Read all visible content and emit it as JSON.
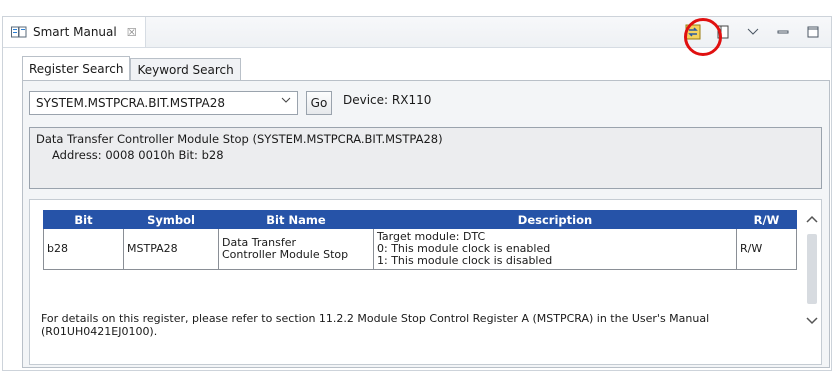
{
  "view": {
    "tab_label": "Smart Manual",
    "tab_close": "☒",
    "icons": [
      "smart-manual-view-icon",
      "link-with-editor-icon",
      "book-icon",
      "view-menu-icon",
      "minimize-icon",
      "maximize-icon"
    ],
    "accent": "#2653a8",
    "highlight_ring_color": "#e01010"
  },
  "tabs": [
    {
      "label": "Register Search",
      "active": true
    },
    {
      "label": "Keyword Search",
      "active": false
    }
  ],
  "search": {
    "selected": "SYSTEM.MSTPCRA.BIT.MSTPA28",
    "go_label": "Go",
    "device": "Device: RX110"
  },
  "info": {
    "line1": "Data Transfer Controller Module Stop (SYSTEM.MSTPCRA.BIT.MSTPA28)",
    "line2": "Address: 0008 0010h  Bit: b28"
  },
  "table": {
    "headers": [
      "Bit",
      "Symbol",
      "Bit Name",
      "Description",
      "R/W"
    ],
    "row": {
      "bit": "b28",
      "symbol": "MSTPA28",
      "bit_name_1": "Data Transfer",
      "bit_name_2": "Controller Module Stop",
      "desc_1": "Target module: DTC",
      "desc_2": "0: This module clock is enabled",
      "desc_3": "1: This module clock is disabled",
      "rw": "R/W"
    }
  },
  "footer": {
    "line1": "For details on this register, please refer to section 11.2.2 Module Stop Control Register A (MSTPCRA) in the User's Manual",
    "line2": "(R01UH0421EJ0100)."
  }
}
